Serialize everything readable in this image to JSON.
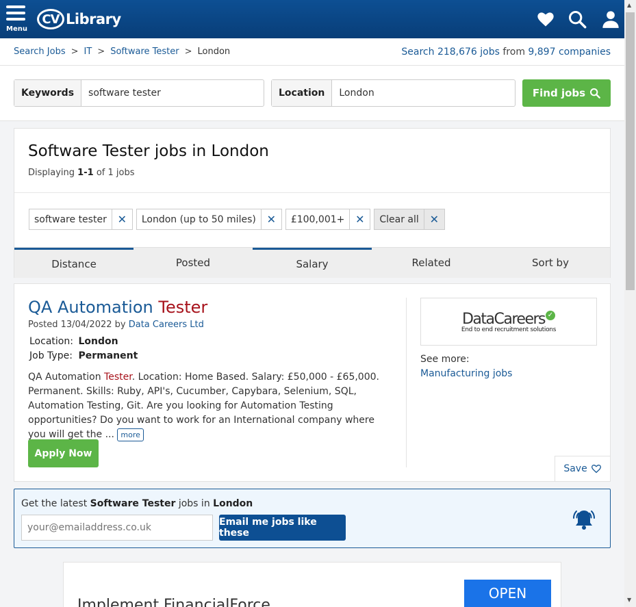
{
  "header": {
    "menu_label": "Menu",
    "logo_cv": "CV",
    "logo_library": "Library"
  },
  "breadcrumb": {
    "items": [
      "Search Jobs",
      "IT",
      "Software Tester"
    ],
    "current": "London",
    "separator": ">"
  },
  "stats": {
    "prefix": "Search",
    "jobs": "218,676 jobs",
    "middle": "from",
    "companies": "9,897 companies"
  },
  "search": {
    "keywords_label": "Keywords",
    "keywords_value": "software tester",
    "location_label": "Location",
    "location_value": "London",
    "find_label": "Find jobs"
  },
  "results": {
    "title": "Software Tester jobs in London",
    "displaying_prefix": "Displaying",
    "displaying_range": "1-1",
    "displaying_suffix": "of 1 jobs",
    "filters": [
      "software tester",
      "London (up to 50 miles)",
      "£100,001+"
    ],
    "clear_all": "Clear all",
    "sort_tabs": [
      "Distance",
      "Posted",
      "Salary",
      "Related",
      "Sort by"
    ]
  },
  "job": {
    "title_prefix": "QA Automation",
    "title_highlight": "Tester",
    "posted_prefix": "Posted 13/04/2022 by",
    "company": "Data Careers Ltd",
    "location_label": "Location:",
    "location_value": "London",
    "type_label": "Job Type:",
    "type_value": "Permanent",
    "desc_part1": "QA Automation",
    "desc_highlight": "Tester",
    "desc_part2": ". Location: Home Based. Salary: £50,000 - £65,000. Permanent. Skills: Ruby, API's, Cucumber, Capybara, Selenium, SQL, Automation Testing, Git. Are you looking for Automation Testing opportunities? Do you want to work for an International company where you will get the ...",
    "more_label": "more",
    "apply_label": "Apply Now",
    "logo_name": "DataCareers",
    "logo_tagline": "End to end recruitment solutions",
    "see_more_label": "See more:",
    "see_more_link": "Manufacturing jobs",
    "save_label": "Save"
  },
  "alert": {
    "text_prefix": "Get the latest",
    "text_job": "Software Tester",
    "text_middle": "jobs in",
    "text_location": "London",
    "email_placeholder": "your@emailaddress.co.uk",
    "button_label": "Email me jobs like these"
  },
  "ad": {
    "text": "Implement FinancialForce",
    "open_label": "OPEN"
  },
  "colors": {
    "brand_blue": "#0d4f93",
    "link_blue": "#1a5a96",
    "green": "#5cb547",
    "highlight_red": "#a7121b"
  }
}
